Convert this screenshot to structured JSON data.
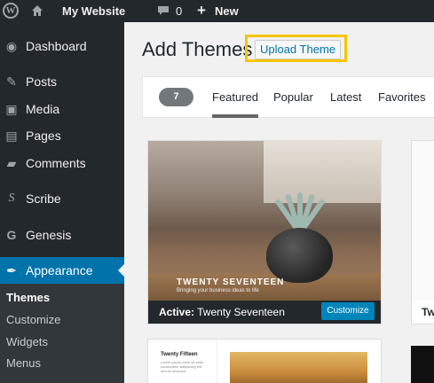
{
  "adminbar": {
    "site_name": "My Website",
    "comment_count": "0",
    "new_label": "New"
  },
  "sidebar": {
    "items": [
      {
        "label": "Dashboard",
        "icon": "dashboard-icon"
      },
      {
        "label": "Posts",
        "icon": "pushpin-icon"
      },
      {
        "label": "Media",
        "icon": "media-icon"
      },
      {
        "label": "Pages",
        "icon": "pages-icon"
      },
      {
        "label": "Comments",
        "icon": "comment-icon"
      },
      {
        "label": "Scribe",
        "icon": "scribe-icon"
      },
      {
        "label": "Genesis",
        "icon": "genesis-icon"
      },
      {
        "label": "Appearance",
        "icon": "paintbrush-icon"
      }
    ],
    "submenu": [
      "Themes",
      "Customize",
      "Widgets",
      "Menus"
    ]
  },
  "main": {
    "title": "Add Themes",
    "upload_button": "Upload Theme",
    "filter": {
      "count": "7",
      "tabs": [
        "Featured",
        "Popular",
        "Latest",
        "Favorites"
      ]
    },
    "active_theme": {
      "brand": "TWENTY SEVENTEEN",
      "tagline": "Bringing your business ideas to life",
      "active_prefix": "Active:",
      "name": "Twenty Seventeen",
      "customize_button": "Customize"
    },
    "right_theme": {
      "name_partial": "Tw"
    },
    "bottom_theme": {
      "mini_title": "Twenty Fifteen",
      "mini_text": "Lorem ipsum dolor sit amet consectetur adipiscing elit sed do eiusmod"
    }
  },
  "colors": {
    "adminbar_bg": "#23282d",
    "accent": "#0073aa",
    "highlight": "#f5c400"
  }
}
